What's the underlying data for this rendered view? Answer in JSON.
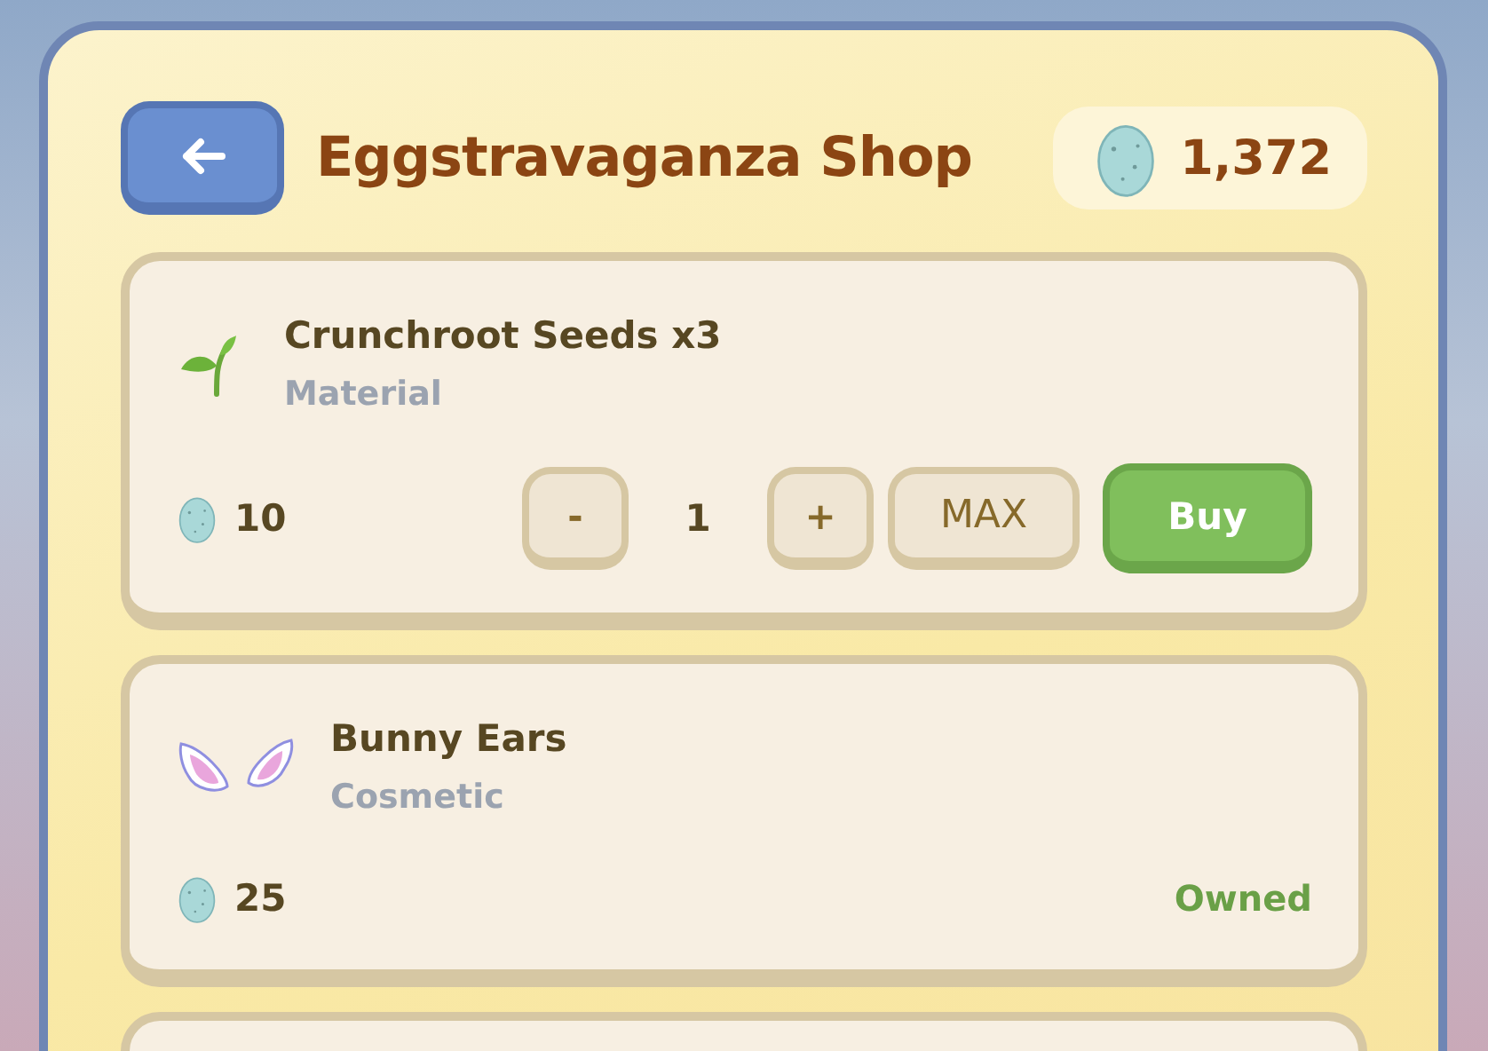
{
  "header": {
    "title": "Eggstravaganza Shop",
    "balance": "1,372"
  },
  "items": [
    {
      "kind": "buy",
      "name": "Crunchroot Seeds x3",
      "category": "Material",
      "price": "10",
      "decrement": "-",
      "quantity": "1",
      "increment": "+",
      "max": "MAX",
      "action": "Buy"
    },
    {
      "kind": "owned",
      "name": "Bunny Ears",
      "category": "Cosmetic",
      "price": "25",
      "status": "Owned"
    }
  ]
}
